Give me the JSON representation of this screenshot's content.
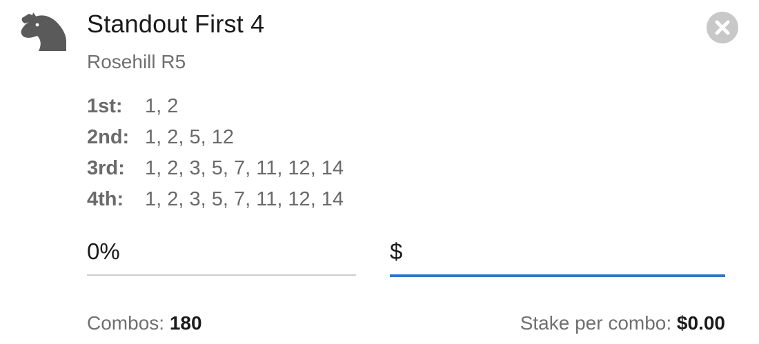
{
  "header": {
    "icon": "horse-head-icon",
    "title": "Standout First 4",
    "subtitle": "Rosehill R5",
    "close_icon": "close-icon"
  },
  "selections": [
    {
      "label": "1st:",
      "values": "1, 2"
    },
    {
      "label": "2nd:",
      "values": "1, 2, 5, 12"
    },
    {
      "label": "3rd:",
      "values": "1, 2, 3, 5, 7, 11, 12, 14"
    },
    {
      "label": "4th:",
      "values": "1, 2, 3, 5, 7, 11, 12, 14"
    }
  ],
  "inputs": {
    "percentage_value": "0%",
    "stake_prefix": "$",
    "stake_value": ""
  },
  "footer": {
    "combos_label": "Combos:",
    "combos_value": "180",
    "stake_per_combo_label": "Stake per combo:",
    "stake_per_combo_value": "$0.00"
  },
  "colors": {
    "active_underline": "#2f76c8",
    "inactive_underline": "#cccccc",
    "close_button": "#c8c8c8",
    "icon": "#5a5a5a"
  }
}
